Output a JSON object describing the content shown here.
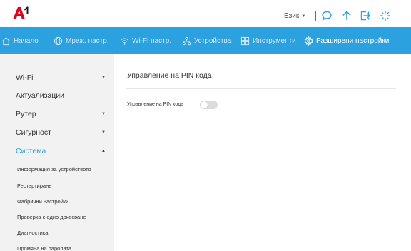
{
  "header": {
    "logo_text": "A1",
    "language_label": "Език",
    "icons": [
      "chat-icon",
      "upload-arrow-icon",
      "logout-icon",
      "loading-icon"
    ],
    "accent_color": "#2ca1e0",
    "logo_color": "#e2001a"
  },
  "nav": {
    "items": [
      {
        "label": "Начало",
        "icon": "home-icon"
      },
      {
        "label": "Мреж. настр.",
        "icon": "globe-icon"
      },
      {
        "label": "Wi-Fi настр.",
        "icon": "wifi-icon"
      },
      {
        "label": "Устройства",
        "icon": "devices-icon"
      },
      {
        "label": "Инструменти",
        "icon": "tools-icon"
      },
      {
        "label": "Разширени настройки",
        "icon": "gear-icon"
      }
    ],
    "active": "Разширени настройки"
  },
  "sidebar": {
    "items": [
      {
        "label": "Wi-Fi",
        "expandable": true
      },
      {
        "label": "Актуализации",
        "expandable": false
      },
      {
        "label": "Рутер",
        "expandable": true
      },
      {
        "label": "Сигурност",
        "expandable": true
      },
      {
        "label": "Система",
        "expandable": true,
        "expanded": true
      }
    ],
    "subitems": [
      "Информация за устройството",
      "Рестартиране",
      "Фабрични настройки",
      "Проверка с едно докосване",
      "Диагностика",
      "Промяна на паролата"
    ]
  },
  "main": {
    "title": "Управление на PIN кода",
    "field_label": "Управление на PIN кода",
    "toggle_on": false
  }
}
